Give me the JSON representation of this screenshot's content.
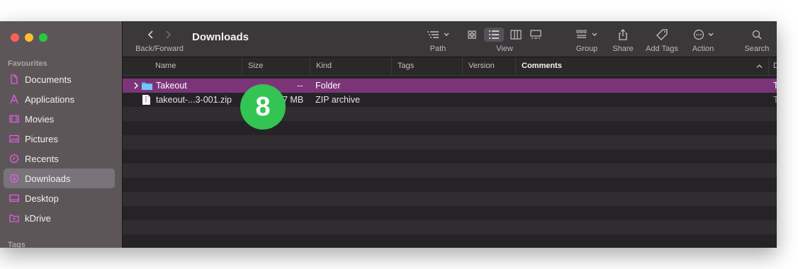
{
  "window": {
    "title": "Downloads"
  },
  "colors": {
    "close": "#fe5f57",
    "minimize": "#febc2e",
    "zoom": "#28c840",
    "accent": "#7c3478",
    "sidebar_icon": "#e05ee0",
    "folder": "#5ab5f5",
    "badge": "#33c453"
  },
  "sidebar": {
    "favourites_label": "Favourites",
    "tags_label": "Tags",
    "items": [
      {
        "label": "Documents",
        "icon": "document-icon"
      },
      {
        "label": "Applications",
        "icon": "applications-icon"
      },
      {
        "label": "Movies",
        "icon": "film-icon"
      },
      {
        "label": "Pictures",
        "icon": "photo-icon"
      },
      {
        "label": "Recents",
        "icon": "clock-icon"
      },
      {
        "label": "Downloads",
        "icon": "download-icon",
        "active": true
      },
      {
        "label": "Desktop",
        "icon": "desktop-icon"
      },
      {
        "label": "kDrive",
        "icon": "drive-folder-icon"
      }
    ]
  },
  "toolbar": {
    "back_forward": "Back/Forward",
    "path": "Path",
    "view": "View",
    "group": "Group",
    "share": "Share",
    "add_tags": "Add Tags",
    "action": "Action",
    "search": "Search"
  },
  "table": {
    "columns": {
      "name": "Name",
      "size": "Size",
      "kind": "Kind",
      "tags": "Tags",
      "version": "Version",
      "comments": "Comments",
      "date_cut": "D"
    },
    "rows": [
      {
        "name": "Takeout",
        "size": "--",
        "kind": "Folder",
        "trail": "T"
      },
      {
        "name": "takeout-...3-001.zip",
        "size": "7 MB",
        "kind": "ZIP archive",
        "trail": "T"
      }
    ]
  },
  "overlay": {
    "step_number": "8"
  }
}
